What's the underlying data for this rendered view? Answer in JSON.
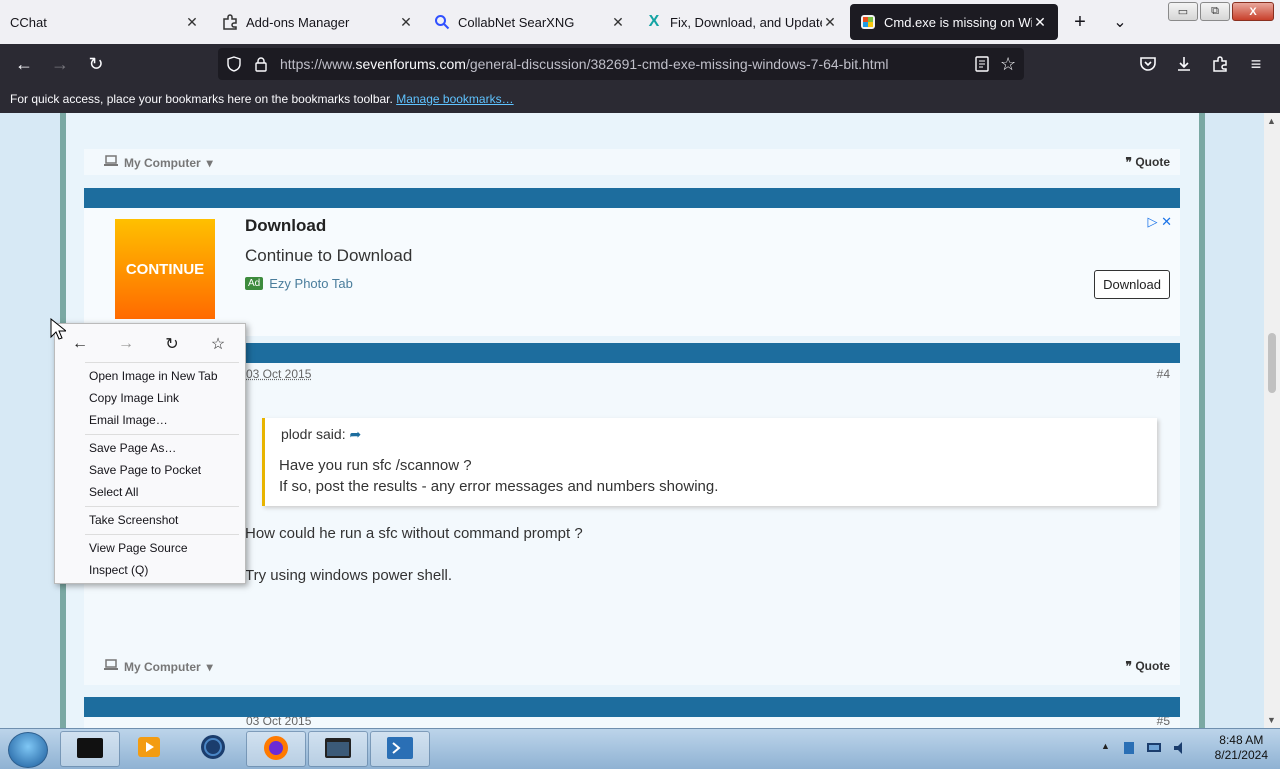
{
  "tabs": [
    {
      "label": "CChat",
      "icon": "none"
    },
    {
      "label": "Add-ons Manager",
      "icon": "puzzle-icon"
    },
    {
      "label": "CollabNet SearXNG",
      "icon": "search-icon"
    },
    {
      "label": "Fix, Download, and Update C",
      "icon": "x-logo-icon"
    },
    {
      "label": "Cmd.exe is missing on Wind",
      "icon": "sevenforums-icon",
      "active": true
    }
  ],
  "new_tab_glyph": "+",
  "tab_list_glyph": "⌄",
  "window_buttons": {
    "minimize": "▭",
    "restore": "⧉",
    "close": "X"
  },
  "nav": {
    "back": "←",
    "forward": "→",
    "reload": "↻",
    "url_prefix": "https://www.",
    "url_domain": "sevenforums.com",
    "url_path": "/general-discussion/382691-cmd-exe-missing-windows-7-64-bit.html"
  },
  "bookmarks_bar": {
    "text": "For quick access, place your bookmarks here on the bookmarks toolbar.",
    "link": "Manage bookmarks…"
  },
  "post1_footer": {
    "my_computer": "My Computer",
    "quote": "Quote"
  },
  "ad": {
    "image_label": "CONTINUE",
    "title": "Download",
    "subtitle": "Continue to Download",
    "badge": "Ad",
    "source": "Ezy Photo Tab",
    "button": "Download",
    "close": "✕"
  },
  "post": {
    "date": "03 Oct 2015",
    "number": "#4",
    "quote_author": "plodr said:",
    "quote_lines": [
      "Have you run sfc /scannow ?",
      "If so, post the results - any error messages and numbers showing."
    ],
    "body_lines": [
      "How could he run a sfc without command prompt ?",
      "Try using windows power shell."
    ],
    "my_computer": "My Computer",
    "quote": "Quote"
  },
  "next_post": {
    "date": "03 Oct 2015",
    "number": "#5"
  },
  "context_menu": {
    "items": [
      "Open Image in New Tab",
      "Copy Image Link",
      "Email Image…",
      "Save Page As…",
      "Save Page to Pocket",
      "Select All",
      "Take Screenshot",
      "View Page Source",
      "Inspect (Q)"
    ]
  },
  "taskbar": {
    "time": "8:48 AM",
    "date": "8/21/2024"
  },
  "colors": {
    "accent_blue": "#1d6d9e",
    "frame_teal": "#7aa8a3",
    "ad_orange": "#ff8c00"
  }
}
